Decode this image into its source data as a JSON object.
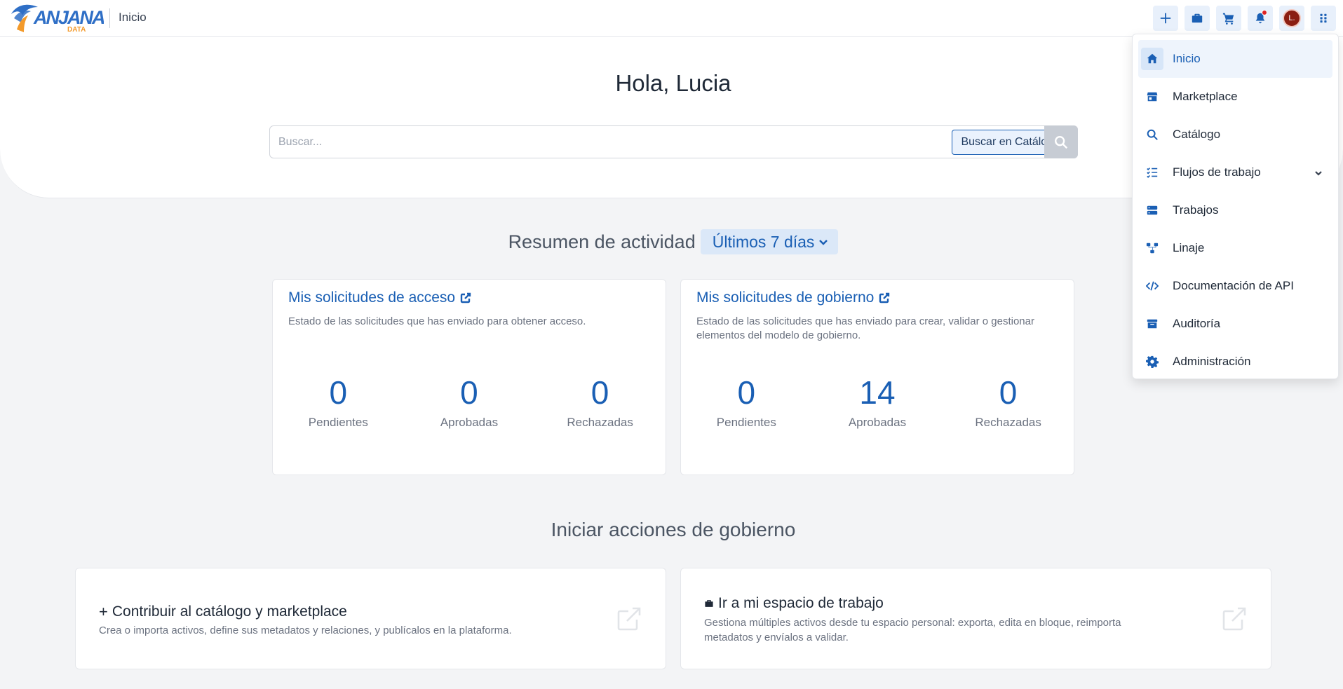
{
  "header": {
    "brand_name": "ANJANA",
    "brand_sub": "DATA",
    "breadcrumb": "Inicio",
    "avatar_initial": "L."
  },
  "hero": {
    "greeting": "Hola, Lucia",
    "search_placeholder": "Buscar...",
    "search_catalog_label": "Buscar en Catálogo"
  },
  "activity": {
    "title": "Resumen de actividad",
    "period": "Últimos 7 días",
    "access_card": {
      "title": "Mis solicitudes de acceso",
      "description": "Estado de las solicitudes que has enviado para obtener acceso.",
      "stats": [
        {
          "value": "0",
          "label": "Pendientes"
        },
        {
          "value": "0",
          "label": "Aprobadas"
        },
        {
          "value": "0",
          "label": "Rechazadas"
        }
      ]
    },
    "governance_card": {
      "title": "Mis solicitudes de gobierno",
      "description": "Estado de las solicitudes que has enviado para crear, validar o gestionar elementos del modelo de gobierno.",
      "stats": [
        {
          "value": "0",
          "label": "Pendientes"
        },
        {
          "value": "14",
          "label": "Aprobadas"
        },
        {
          "value": "0",
          "label": "Rechazadas"
        }
      ]
    }
  },
  "actions": {
    "title": "Iniciar acciones de gobierno",
    "contribute": {
      "title": "Contribuir al catálogo y marketplace",
      "description": "Crea o importa activos, define sus metadatos y relaciones, y publícalos en la plataforma."
    },
    "workspace": {
      "title": "Ir a mi espacio de trabajo",
      "description": "Gestiona múltiples activos desde tu espacio personal: exporta, edita en bloque, reimporta metadatos y envíalos a validar."
    }
  },
  "menu": {
    "items": [
      {
        "label": "Inicio",
        "icon": "home-icon"
      },
      {
        "label": "Marketplace",
        "icon": "store-icon"
      },
      {
        "label": "Catálogo",
        "icon": "search-icon"
      },
      {
        "label": "Flujos de trabajo",
        "icon": "list-check-icon"
      },
      {
        "label": "Trabajos",
        "icon": "server-icon"
      },
      {
        "label": "Linaje",
        "icon": "lineage-icon"
      },
      {
        "label": "Documentación de API",
        "icon": "code-icon"
      },
      {
        "label": "Auditoría",
        "icon": "archive-icon"
      },
      {
        "label": "Administración",
        "icon": "gear-icon"
      }
    ]
  },
  "colors": {
    "accent": "#1a5fb4",
    "brand_blue": "#2f6fc6",
    "brand_orange": "#f39a2b",
    "notification": "#e02424",
    "avatar_bg": "#8b1e12"
  }
}
